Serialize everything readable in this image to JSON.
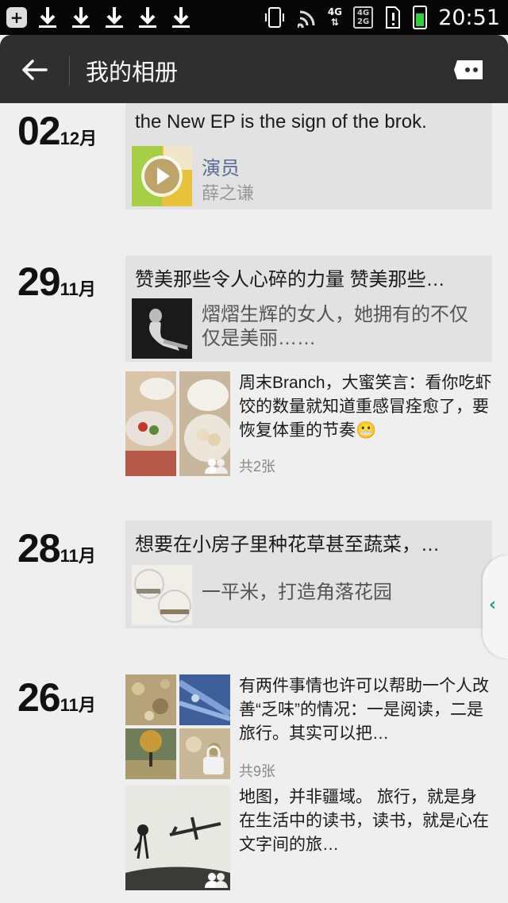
{
  "status_bar": {
    "network": "4G",
    "sim_label_1": "4G",
    "sim_label_2": "2G",
    "time": "20:51"
  },
  "header": {
    "title": "我的相册",
    "back_icon": "back-arrow-icon",
    "message_icon": "message-icon"
  },
  "colors": {
    "header_bg": "#2f2f2f",
    "link": "#576b95",
    "accent": "#1aa37a"
  },
  "posts": [
    {
      "day": "02",
      "month": "12月",
      "card": {
        "title": "the New EP is the sign of the brok.",
        "music_title": "演员",
        "music_artist": "薛之谦"
      }
    },
    {
      "day": "29",
      "month": "11月",
      "card": {
        "title": "赞美那些令人心碎的力量 赞美那些…",
        "text": "熠熠生辉的女人，她拥有的不仅仅是美丽……"
      },
      "photo_post": {
        "text": "周末Branch，大蜜笑言：看你吃虾饺的数量就知道重感冒痊愈了，要恢复体重的节奏😬",
        "count": "共2张"
      }
    },
    {
      "day": "28",
      "month": "11月",
      "card": {
        "title": "想要在小房子里种花草甚至蔬菜，…",
        "text": "一平米，打造角落花园"
      }
    },
    {
      "day": "26",
      "month": "11月",
      "photo_post": {
        "text": "有两件事情也许可以帮助一个人改善“乏味”的情况：一是阅读，二是旅行。其实可以把…",
        "count": "共9张"
      },
      "photo_post_2": {
        "text": "地图，并非疆域。 旅行，就是身在生活中的读书，读书，就是心在文字间的旅…"
      }
    }
  ]
}
